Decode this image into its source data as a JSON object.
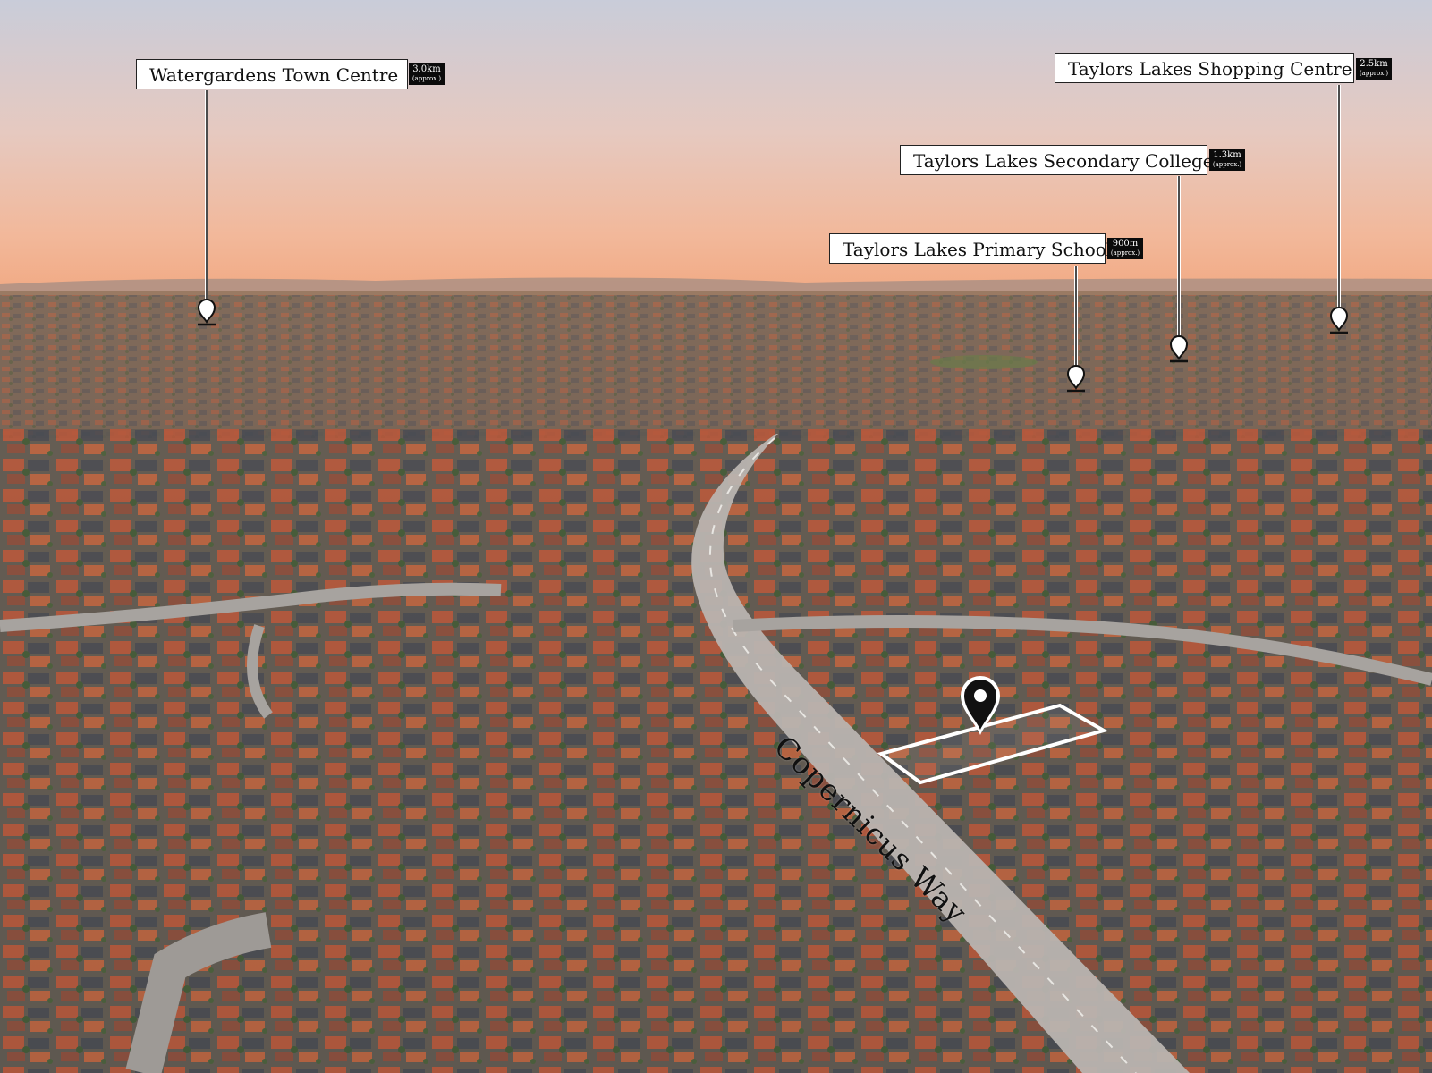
{
  "photo": {
    "subject": "Aerial suburban view at dusk",
    "sky_colors": [
      "#c9ccd9",
      "#e6c9c0",
      "#f2b89a",
      "#f1a983"
    ],
    "ground_colors": [
      "#8b6b55",
      "#6d5a4b",
      "#4f4a44"
    ],
    "road_color": "#b9b4b0",
    "roof_colors": [
      "#c2573a",
      "#b84a2e",
      "#3f4147",
      "#8c4d3b",
      "#5a3a32"
    ]
  },
  "poi_labels": [
    {
      "name": "Watergardens Town Centre",
      "distance": "3.0km",
      "approx": "(approx.)",
      "icon": "map-pin-icon"
    },
    {
      "name": "Taylors Lakes Shopping Centre",
      "distance": "2.5km",
      "approx": "(approx.)",
      "icon": "map-pin-icon"
    },
    {
      "name": "Taylors Lakes Secondary College",
      "distance": "1.3km",
      "approx": "(approx.)",
      "icon": "map-pin-icon"
    },
    {
      "name": "Taylors Lakes Primary School",
      "distance": "900m",
      "approx": "(approx.)",
      "icon": "map-pin-icon"
    }
  ],
  "street_name": "Copernicus Way",
  "property_marker": {
    "icon": "location-pin-icon",
    "outline_color": "#ffffff"
  }
}
